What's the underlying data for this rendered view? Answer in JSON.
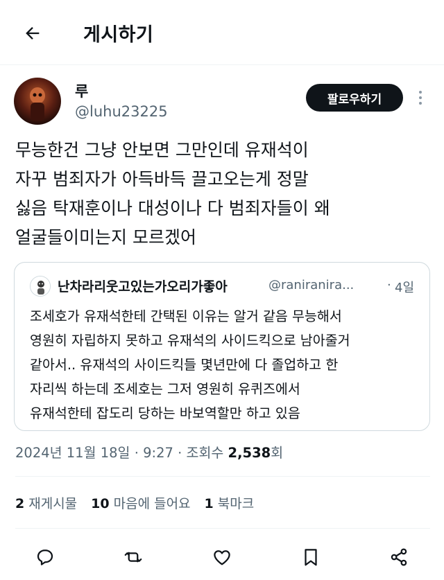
{
  "header": {
    "title": "게시하기"
  },
  "author": {
    "name": "루",
    "handle": "@luhu23225"
  },
  "follow_label": "팔로우하기",
  "tweet_lines": [
    "무능한건 그냥 안보면 그만인데 유재석이",
    "자꾸 범죄자가 아득바득 끌고오는게 정말",
    "싫음 탁재훈이나 대성이나 다 범죄자들이 왜",
    "얼굴들이미는지 모르겠어"
  ],
  "quote": {
    "name": "난차라리웃고있는가오리가좋아",
    "handle": "@raniranira...",
    "separator": "·",
    "time": "4일",
    "lines": [
      "조세호가 유재석한테 간택된 이유는 알거 같음 무능해서",
      "영원히 자립하지 못하고 유재석의 사이드킥으로 남아줄거",
      "같아서.. 유재석의 사이드킥들 몇년만에 다 졸업하고 한",
      "자리씩 하는데 조세호는 그저 영원히 유퀴즈에서",
      "유재석한테 잡도리 당하는 바보역할만  하고 있음"
    ]
  },
  "meta": {
    "date": "2024년 11월 18일",
    "sep1": "·",
    "time": "9:27",
    "sep2": "·",
    "views_label": "조회수",
    "views_count": "2,538",
    "views_unit": "회"
  },
  "stats": {
    "reposts_count": "2",
    "reposts_label": "재게시물",
    "likes_count": "10",
    "likes_label": "마음에 들어요",
    "bookmarks_count": "1",
    "bookmarks_label": "북마크"
  },
  "icons": {
    "back": "arrow-left-icon",
    "more": "more-vertical-icon",
    "reply": "reply-icon",
    "repost": "repost-icon",
    "like": "heart-icon",
    "bookmark": "bookmark-icon",
    "share": "share-icon"
  },
  "colors": {
    "text": "#0f1419",
    "secondary": "#536471",
    "border": "#cfd9de",
    "divider": "#eff3f4",
    "follow_bg": "#0f1419"
  }
}
